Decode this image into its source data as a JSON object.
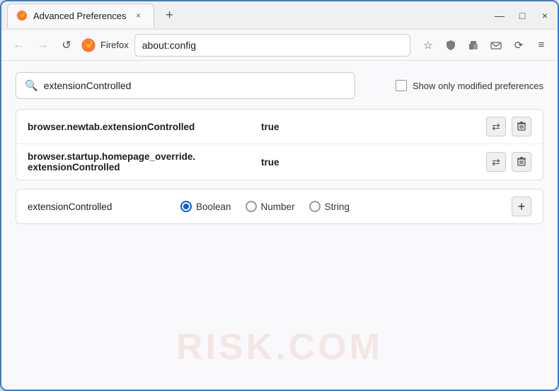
{
  "window": {
    "title": "Advanced Preferences",
    "tab_label": "Advanced Preferences",
    "close_label": "×",
    "minimize_label": "—",
    "maximize_label": "□",
    "new_tab_label": "+"
  },
  "navbar": {
    "back_icon": "←",
    "forward_icon": "→",
    "refresh_icon": "↺",
    "browser_name": "Firefox",
    "url": "about:config",
    "bookmark_icon": "☆",
    "shield_icon": "🛡",
    "extension_icon": "🧩",
    "mail_icon": "✉",
    "sync_icon": "⟳",
    "menu_icon": "≡"
  },
  "search": {
    "placeholder": "extensionControlled",
    "value": "extensionControlled",
    "show_modified_label": "Show only modified preferences",
    "search_icon": "🔍"
  },
  "results": [
    {
      "name": "browser.newtab.extensionControlled",
      "value": "true",
      "toggle_icon": "⇄",
      "delete_icon": "🗑"
    },
    {
      "name_line1": "browser.startup.homepage_override.",
      "name_line2": "extensionControlled",
      "value": "true",
      "toggle_icon": "⇄",
      "delete_icon": "🗑"
    }
  ],
  "add_row": {
    "name": "extensionControlled",
    "radio_boolean_label": "Boolean",
    "radio_number_label": "Number",
    "radio_string_label": "String",
    "plus_icon": "+",
    "selected": "boolean"
  },
  "watermark": "RISK.COM"
}
